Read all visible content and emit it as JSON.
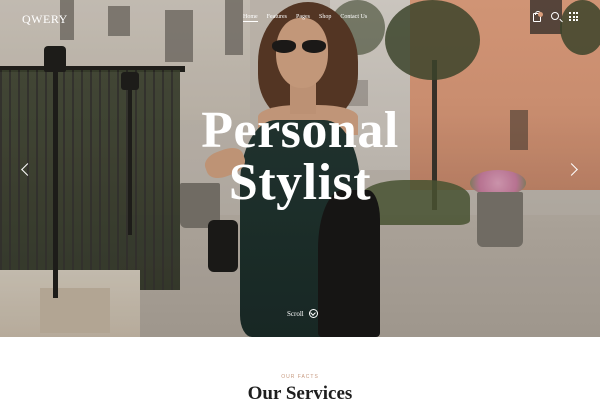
{
  "header": {
    "logo": "QWERY",
    "nav": [
      {
        "label": "Home",
        "active": true
      },
      {
        "label": "Features",
        "active": false
      },
      {
        "label": "Pages",
        "active": false
      },
      {
        "label": "Shop",
        "active": false
      },
      {
        "label": "Contact Us",
        "active": false
      }
    ],
    "icons": [
      "shopping-bag-icon",
      "search-icon",
      "grid-menu-icon"
    ],
    "accent_color": "#d89c7a"
  },
  "hero": {
    "title_line1": "Personal",
    "title_line2": "Stylist",
    "scroll_label": "Scroll",
    "prev_icon": "chevron-left-icon",
    "next_icon": "chevron-right-icon"
  },
  "services": {
    "eyebrow": "OUR FACTS",
    "title": "Our Services"
  }
}
